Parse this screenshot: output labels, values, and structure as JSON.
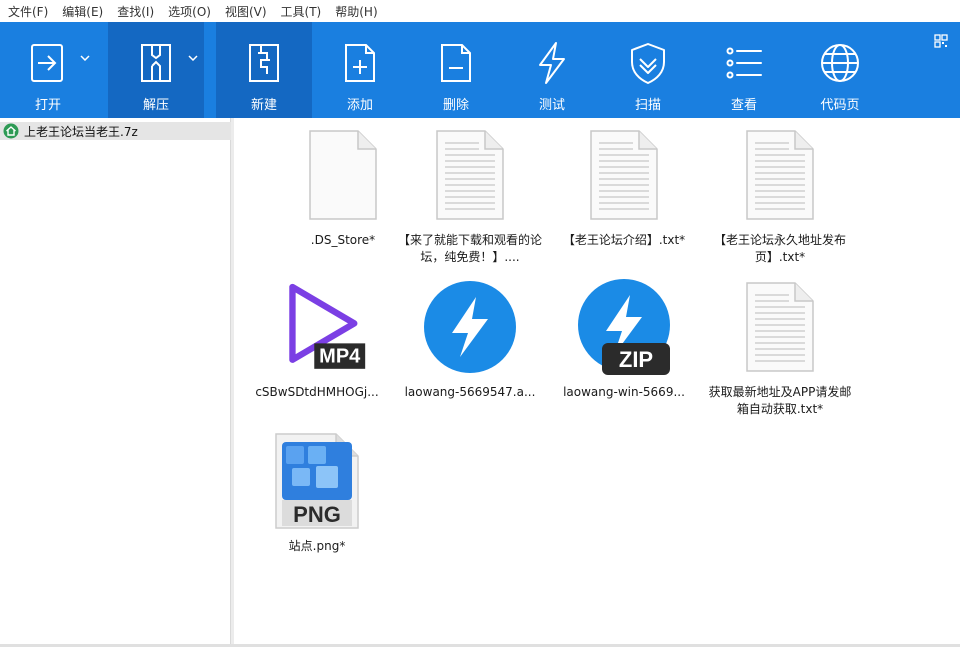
{
  "menu": [
    "文件(F)",
    "编辑(E)",
    "查找(I)",
    "选项(O)",
    "视图(V)",
    "工具(T)",
    "帮助(H)"
  ],
  "toolbar": {
    "open": "打开",
    "extract": "解压",
    "new": "新建",
    "add": "添加",
    "delete": "删除",
    "test": "测试",
    "scan": "扫描",
    "view": "查看",
    "code_page": "代码页"
  },
  "tree": {
    "archive": "上老王论坛当老王.7z"
  },
  "files": [
    {
      "name": ".DS_Store*",
      "type": "generic"
    },
    {
      "name": "【来了就能下载和观看的论坛，纯免费！】....",
      "type": "text"
    },
    {
      "name": "【老王论坛介绍】.txt*",
      "type": "text"
    },
    {
      "name": "【老王论坛永久地址发布页】.txt*",
      "type": "text"
    },
    {
      "name": "cSBwSDtdHMHOGj...",
      "type": "mp4",
      "badge": "MP4"
    },
    {
      "name": "laowang-5669547.a...",
      "type": "app"
    },
    {
      "name": "laowang-win-5669...",
      "type": "zip",
      "badge": "ZIP"
    },
    {
      "name": "获取最新地址及APP请发邮箱自动获取.txt*",
      "type": "text"
    },
    {
      "name": "站点.png*",
      "type": "png",
      "badge": "PNG"
    }
  ],
  "colors": {
    "toolbar": "#1a7fe0",
    "toolbar_active": "#1468c2",
    "app_icon": "#1b8be6",
    "mp4_purple": "#7b3fe4"
  }
}
